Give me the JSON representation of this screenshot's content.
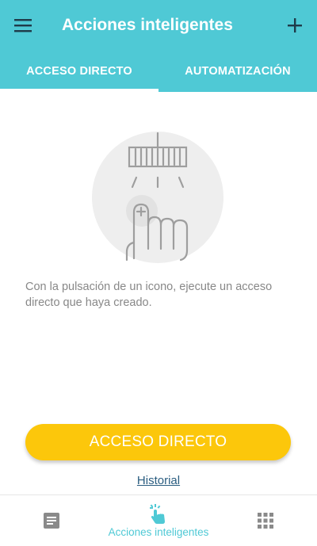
{
  "app_bar": {
    "title": "Acciones inteligentes",
    "menu_icon": "hamburger-menu-icon",
    "add_icon": "plus-icon",
    "background_color": "#4fc9d5"
  },
  "tabs": [
    {
      "label": "ACCESO DIRECTO",
      "active": true
    },
    {
      "label": "AUTOMATIZACIÓN",
      "active": false
    }
  ],
  "empty_state": {
    "illustration": "tap-shortcut-illustration",
    "description": "Con la pulsación de un icono, ejecute un acceso directo que haya creado."
  },
  "primary_button": {
    "label": "ACCESO DIRECTO",
    "color": "#fcc70b"
  },
  "history_link": {
    "label": "Historial"
  },
  "bottom_nav": {
    "items": [
      {
        "icon": "document-icon",
        "label": "",
        "active": false
      },
      {
        "icon": "smart-actions-tap-icon",
        "label": "Acciones inteligentes",
        "active": true
      },
      {
        "icon": "apps-grid-icon",
        "label": "",
        "active": false
      }
    ],
    "active_color": "#4fc9d5",
    "inactive_color": "#8a8a8a"
  }
}
